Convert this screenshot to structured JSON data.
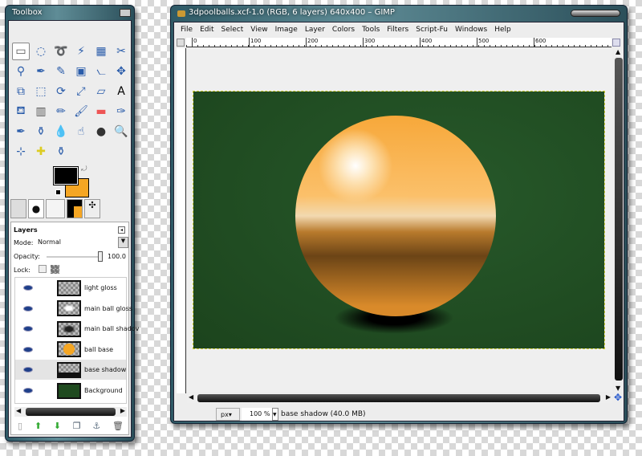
{
  "toolbox": {
    "title": "Toolbox",
    "tools": [
      "rect-select",
      "ellipse-select",
      "free-select",
      "fuzzy-select",
      "color-select",
      "scissors",
      "foreground-select",
      "paths",
      "color-picker",
      "zoom-crop",
      "measure",
      "move",
      "align",
      "crop",
      "rotate",
      "scale",
      "shear",
      "text",
      "bucket-fill",
      "blend",
      "pencil",
      "paintbrush",
      "eraser",
      "airbrush",
      "ink",
      "clone",
      "blur",
      "smudge",
      "dodge-burn",
      "magnify",
      "perspective-clone-placeholder",
      "heal",
      "clone-perspective"
    ],
    "fg_color": "#000000",
    "bg_color": "#f5a623"
  },
  "layers": {
    "title": "Layers",
    "mode_label": "Mode:",
    "mode_value": "Normal",
    "opacity_label": "Opacity:",
    "opacity_value": "100.0",
    "lock_label": "Lock:",
    "items": [
      {
        "name": "light gloss"
      },
      {
        "name": "main ball gloss"
      },
      {
        "name": "main ball shadov"
      },
      {
        "name": "ball base"
      },
      {
        "name": "base shadow",
        "selected": true
      },
      {
        "name": "Background"
      }
    ]
  },
  "image_window": {
    "title": "3dpoolballs.xcf-1.0 (RGB, 6 layers) 640x400 – GIMP",
    "menu": [
      "File",
      "Edit",
      "Select",
      "View",
      "Image",
      "Layer",
      "Colors",
      "Tools",
      "Filters",
      "Script-Fu",
      "Windows",
      "Help"
    ],
    "ruler": [
      "0",
      "100",
      "200",
      "300",
      "400",
      "500",
      "600"
    ],
    "unit": "px",
    "zoom": "100 %",
    "status": "base shadow (40.0 MB)",
    "canvas_color": "#1f4a1f",
    "ball_color": "#f5a835"
  }
}
